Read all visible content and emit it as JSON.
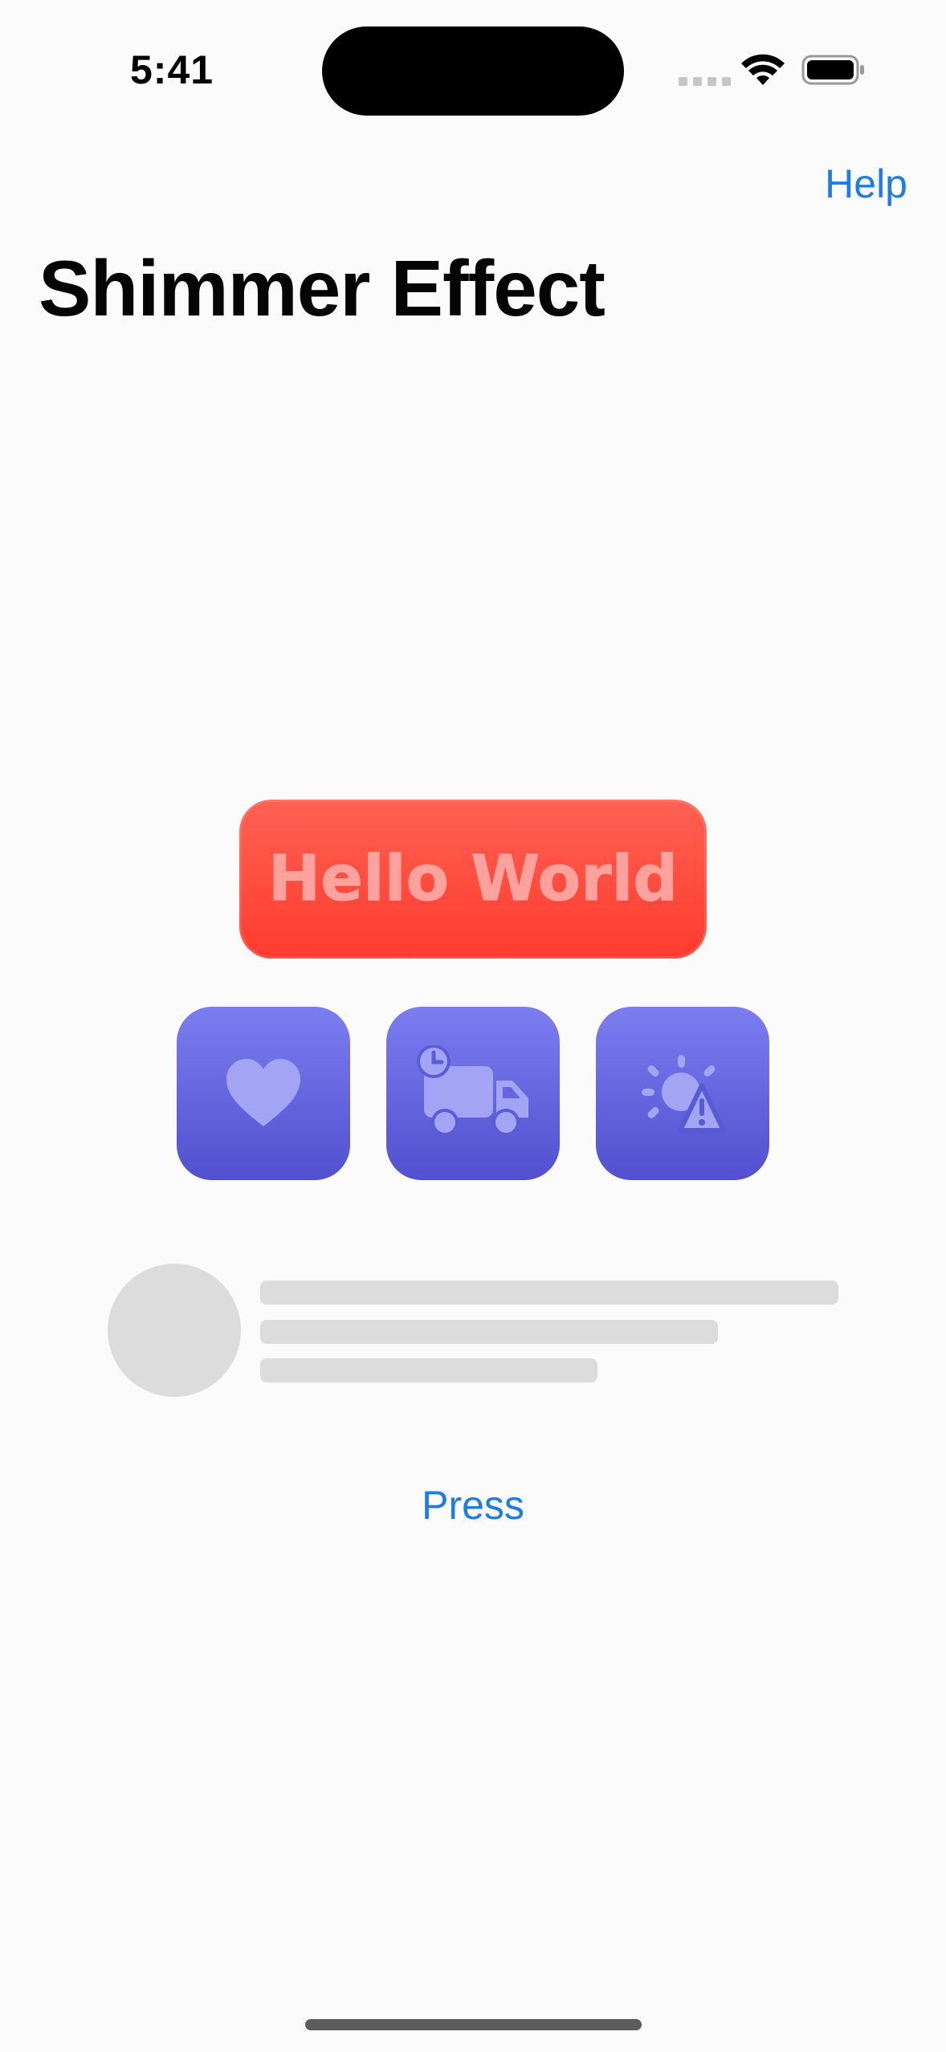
{
  "status_bar": {
    "time": "5:41"
  },
  "nav": {
    "help_label": "Help",
    "title": "Shimmer Effect"
  },
  "hero_button": {
    "label": "Hello World",
    "color": "#ff3b2e"
  },
  "icon_tiles": [
    {
      "icon": "heart-icon"
    },
    {
      "icon": "delivery-truck-clock-icon"
    },
    {
      "icon": "sun-warning-icon"
    }
  ],
  "skeleton": {
    "avatar": "placeholder-avatar",
    "lines": 3
  },
  "press_label": "Press",
  "colors": {
    "accent": "#1d7ce6",
    "tile": "#5b5ad6",
    "skeleton": "#dcdcdd",
    "background": "#fbfbfb"
  }
}
